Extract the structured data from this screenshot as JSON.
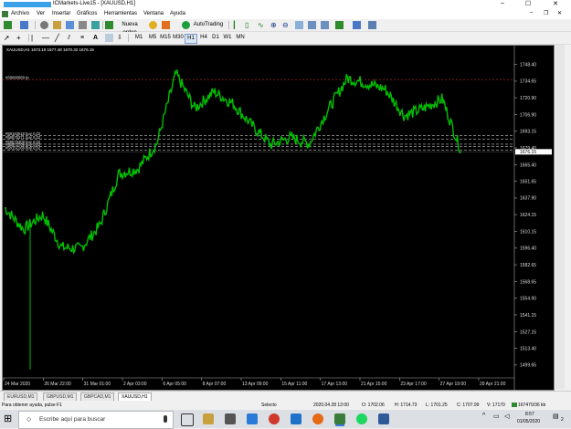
{
  "window": {
    "title": "ICMarkets-Live15 - [XAUUSD,H1]",
    "controls": [
      "–",
      "☐",
      "✕"
    ],
    "mdi_controls": [
      "–",
      "❐",
      "✕"
    ]
  },
  "menu": [
    "Archivo",
    "Ver",
    "Insertar",
    "Gráficos",
    "Herramientas",
    "Ventana",
    "Ayuda"
  ],
  "toolbar1": {
    "new_order": "Nueva orden",
    "autotrading": "AutoTrading"
  },
  "toolbar2": {
    "timeframes": [
      "M1",
      "M5",
      "M15",
      "M30",
      "H1",
      "H4",
      "D1",
      "W1",
      "MN"
    ],
    "active_timeframe": "H1"
  },
  "chart": {
    "info": "XAUUSD,H1  1673.19 1677.48 1670.32 1676.15",
    "order_labels": [
      {
        "text": "#58680689 tp",
        "price": 1736
      },
      {
        "text": "#58163518 buy 0.02",
        "price": 1689.5
      },
      {
        "text": "#58575371 buy 0.02",
        "price": 1686.5
      },
      {
        "text": "#58575309 buy 0.02",
        "price": 1682.5
      },
      {
        "text": "#58571709 buy 0.02",
        "price": 1680.5
      },
      {
        "text": "#58151268 buy 0.02",
        "price": 1677.5
      }
    ],
    "current_price": "1676.15",
    "price_ticks": [
      "1748.40",
      "1734.65",
      "1720.90",
      "1706.90",
      "1693.15",
      "1679.40",
      "1665.40",
      "1651.65",
      "1637.90",
      "1624.15",
      "1610.15",
      "1596.40",
      "1582.65",
      "1568.65",
      "1554.90",
      "1541.15",
      "1527.15",
      "1513.40",
      "1499.65"
    ],
    "time_ticks": [
      "24 Mar 2020",
      "26 Mar 22:00",
      "31 Mar 01:00",
      "2 Apr 03:00",
      "6 Apr 05:00",
      "8 Apr 07:00",
      "13 Apr 09:00",
      "15 Apr 11:00",
      "17 Apr 13:00",
      "21 Apr 15:00",
      "23 Apr 17:00",
      "27 Apr 19:00",
      "29 Apr 21:00"
    ],
    "colors": {
      "candles": "#00c000",
      "order_line": "#c0c0c0",
      "tp_line": "#cc2a2a",
      "background": "#000000"
    }
  },
  "chart_data": {
    "type": "line",
    "title": "XAUUSD,H1",
    "xlabel": "",
    "ylabel": "",
    "ylim": [
      1492,
      1755
    ],
    "x": [
      "24 Mar 2020",
      "26 Mar 22:00",
      "31 Mar 01:00",
      "2 Apr 03:00",
      "6 Apr 05:00",
      "8 Apr 07:00",
      "13 Apr 09:00",
      "15 Apr 11:00",
      "17 Apr 13:00",
      "21 Apr 15:00",
      "23 Apr 17:00",
      "27 Apr 19:00",
      "29 Apr 21:00"
    ],
    "series": [
      {
        "values": [
          1630,
          1612,
          1624,
          1597,
          1596,
          1615,
          1658,
          1662,
          1683,
          1741,
          1712,
          1726,
          1716,
          1698,
          1682,
          1688,
          1683,
          1711,
          1737,
          1733,
          1728,
          1706,
          1712,
          1720,
          1676
        ]
      }
    ]
  },
  "tabs": [
    "EURUSD,M1",
    "GBPUSD,M1",
    "GBPCAD,M1",
    "XAUUSD,H1"
  ],
  "active_tab": "XAUUSD,H1",
  "status": {
    "help": "Para obtener ayuda, pulse F1",
    "profile": "Selecto",
    "datetime": "2020.04.28 12:00",
    "open": "O: 1702.06",
    "high": "H: 1714.73",
    "low": "L: 1701.25",
    "close": "C: 1707.99",
    "volume": "V: 17170",
    "traffic": "167470/36 kb"
  },
  "taskbar": {
    "search_placeholder": "Escribe aquí para buscar",
    "clock_time": "8:57",
    "clock_date": "01/05/2020",
    "notif_count": "2"
  }
}
